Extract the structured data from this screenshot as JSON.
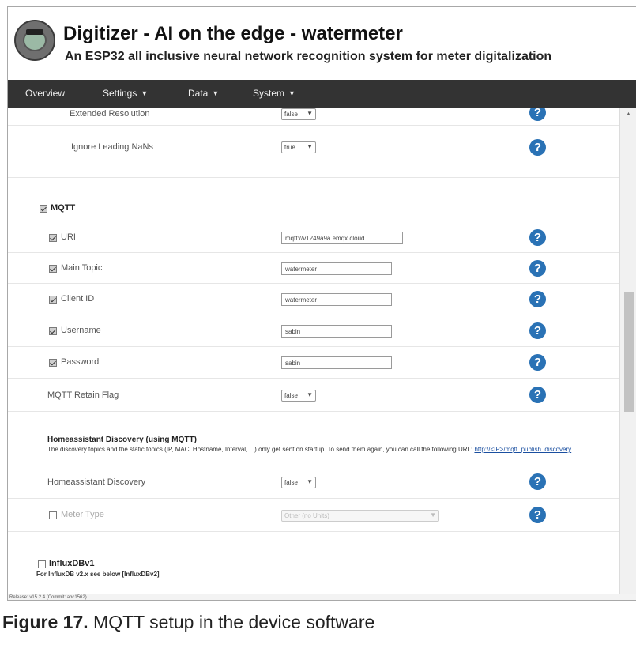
{
  "header": {
    "title": "Digitizer - AI on the edge - watermeter",
    "subtitle": "An ESP32 all inclusive neural network recognition system for meter digitalization"
  },
  "nav": {
    "items": [
      {
        "label": "Overview",
        "has_dropdown": false
      },
      {
        "label": "Settings",
        "has_dropdown": true
      },
      {
        "label": "Data",
        "has_dropdown": true
      },
      {
        "label": "System",
        "has_dropdown": true
      }
    ]
  },
  "rows": {
    "extended_resolution": {
      "label": "Extended Resolution",
      "value": "false"
    },
    "ignore_leading_nans": {
      "label": "Ignore Leading NaNs",
      "value": "true"
    },
    "mqtt_section": {
      "label": "MQTT",
      "checked": true
    },
    "uri": {
      "label": "URI",
      "checked": true,
      "value": "mqtt://v1249a9a.emqx.cloud"
    },
    "main_topic": {
      "label": "Main Topic",
      "checked": true,
      "value": "watermeter"
    },
    "client_id": {
      "label": "Client ID",
      "checked": true,
      "value": "watermeter"
    },
    "username": {
      "label": "Username",
      "checked": true,
      "value": "sabin"
    },
    "password": {
      "label": "Password",
      "checked": true,
      "value": "sabin"
    },
    "retain_flag": {
      "label": "MQTT Retain Flag",
      "value": "false"
    },
    "ha_section": {
      "title": "Homeassistant Discovery (using MQTT)",
      "description": "The discovery topics and the static topics (IP, MAC, Hostname, Interval, ...) only get sent on startup. To send them again, you can call the following URL:",
      "link": "http://<IP>/mqtt_publish_discovery"
    },
    "ha_discovery": {
      "label": "Homeassistant Discovery",
      "value": "false"
    },
    "meter_type": {
      "label": "Meter Type",
      "checked": false,
      "value": "Other (no Units)",
      "disabled": true
    },
    "influx_section": {
      "label": "InfluxDBv1",
      "checked": false,
      "note": "For InfluxDB v2.x see below [InfluxDBv2]"
    }
  },
  "help_icon_glyph": "?",
  "footer": {
    "version": "Release: v15.2.4 (Commit: abc1562)"
  },
  "caption": {
    "prefix": "Figure 17.",
    "text": " MQTT setup in the device software"
  },
  "colors": {
    "nav_bg": "#333333",
    "help_icon": "#2a72b5"
  }
}
